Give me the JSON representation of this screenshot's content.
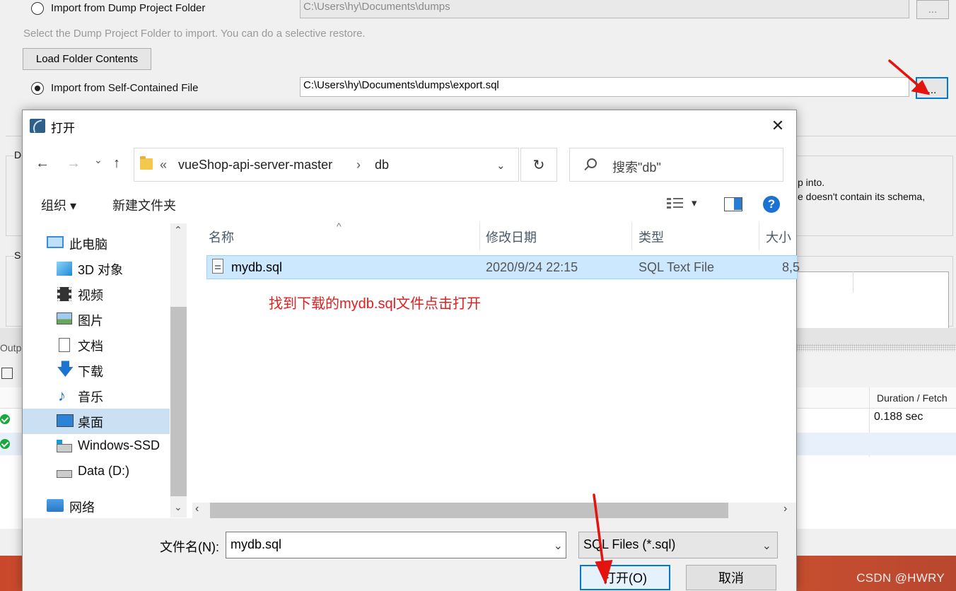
{
  "background": {
    "dump_folder_option": "Import from Dump Project Folder",
    "dump_folder_path": "C:\\Users\\hy\\Documents\\dumps",
    "dump_browse_label": "...",
    "dump_folder_hint": "Select the Dump Project Folder to import. You can do a selective restore.",
    "load_button": "Load Folder Contents",
    "self_contained_option": "Import from Self-Contained File",
    "self_contained_path": "C:\\Users\\hy\\Documents\\dumps\\export.sql",
    "self_contained_browse_label": "...",
    "section_d_label": "D",
    "section_s_label": "S",
    "right_text_1": "p into.",
    "right_text_2": "e doesn't contain its schema,",
    "output_label": "Outp",
    "duration_header": "Duration / Fetch",
    "duration_value": "0.188 sec",
    "status_color": "#18a83b"
  },
  "dialog": {
    "title": "打开",
    "close_label": "✕",
    "nav": {
      "back": "←",
      "forward": "→",
      "recent": "⌄",
      "up": "↑",
      "breadcrumb_prefix": "«",
      "breadcrumb": [
        "vueShop-api-server-master",
        "db"
      ],
      "breadcrumb_separator": "›",
      "dropdown": "⌄",
      "refresh": "↻",
      "search_placeholder": "搜索\"db\""
    },
    "toolbar": {
      "organize": "组织 ▾",
      "new_folder": "新建文件夹",
      "view_arrow": "▾",
      "help": "?"
    },
    "sidebar": {
      "items": [
        {
          "label": "此电脑",
          "icon": "computer-icon"
        },
        {
          "label": "3D 对象",
          "icon": "3d-objects-icon"
        },
        {
          "label": "视频",
          "icon": "video-icon"
        },
        {
          "label": "图片",
          "icon": "pictures-icon"
        },
        {
          "label": "文档",
          "icon": "documents-icon"
        },
        {
          "label": "下载",
          "icon": "download-icon"
        },
        {
          "label": "音乐",
          "icon": "music-icon"
        },
        {
          "label": "桌面",
          "icon": "desktop-icon",
          "selected": true
        },
        {
          "label": "Windows-SSD",
          "icon": "drive-icon"
        },
        {
          "label": "Data (D:)",
          "icon": "drive-icon"
        },
        {
          "label": "网络",
          "icon": "network-icon"
        }
      ]
    },
    "columns": [
      "名称",
      "修改日期",
      "类型",
      "大小"
    ],
    "files": [
      {
        "name": "mydb.sql",
        "modified": "2020/9/24 22:15",
        "type": "SQL Text File",
        "size": "8,5"
      }
    ],
    "annotation": "找到下载的mydb.sql文件点击打开",
    "filename_label": "文件名(N):",
    "filename_value": "mydb.sql",
    "filetype_value": "SQL Files (*.sql)",
    "open_button": "打开(O)",
    "cancel_button": "取消",
    "accent_color": "#0078d7",
    "annotation_color": "#e02020"
  },
  "watermark": "CSDN @HWRY"
}
